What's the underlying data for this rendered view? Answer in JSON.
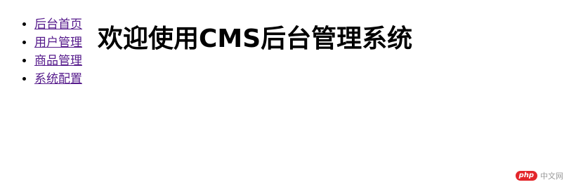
{
  "nav": {
    "items": [
      {
        "label": "后台首页"
      },
      {
        "label": "用户管理"
      },
      {
        "label": "商品管理"
      },
      {
        "label": "系统配置"
      }
    ]
  },
  "main": {
    "title": "欢迎使用CMS后台管理系统"
  },
  "watermark": {
    "badge": "php",
    "text": "中文网"
  },
  "colors": {
    "link_visited": "#551a8b",
    "watermark_red": "#e3262b"
  }
}
